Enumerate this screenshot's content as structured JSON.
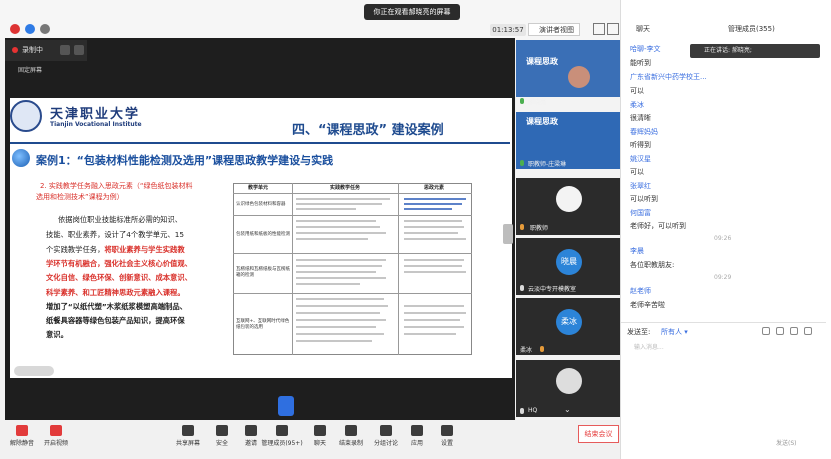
{
  "top_bar": {
    "share_banner": "你正在观看郝晓亮的屏幕",
    "timer": "01:13:57",
    "view_mode": "演讲者视图"
  },
  "stage": {
    "recording_label": "录制中",
    "pin_label": "固定屏幕"
  },
  "slide": {
    "university_cn": "天津职业大学",
    "university_en": "Tianjin Vocational Institute",
    "section_title": "四、“课程思政” 建设案例",
    "case_title": "案例1：“包装材料性能检测及选用”课程思政教学建设与实践",
    "subheading_line1": "2. 实践教学任务融入思政元素（“绿色纸包装材料",
    "subheading_line2": "选用和检测技术”课程为例）",
    "body": {
      "l1": "依据岗位职业技能标准所必需的知识、",
      "l2": "技能、职业素养，设计了4个教学单元、15",
      "l3a": "个实践教学任务，",
      "l3b": "将职业素养与学生实践教",
      "l4": "学环节有机融合，强化社会主义核心价值观、",
      "l5": "文化自信、绿色环保、创新意识、成本意识、",
      "l6": "科学素养、和工匠精神思政元素融入课程。",
      "l7": "增加了“以纸代塑”木浆纸浆模塑高端制品、",
      "l8": "纸餐具容器等绿色包装产品知识，提高环保",
      "l9": "意识。"
    },
    "table": {
      "headers": [
        "教学单元",
        "实践教学任务",
        "思政元素"
      ],
      "unit_1": "认识绿色包装材料和容器",
      "unit_2": "包装用纸和纸板的性能检测",
      "unit_3": "瓦楞纸和瓦楞纸板与瓦楞纸箱的检测",
      "unit_4": "互联网+、互联网时代绿色纸包装的选用"
    }
  },
  "videos": [
    {
      "name": "郝晓亮",
      "banner": "课程思政"
    },
    {
      "name": "职教师-庄梁琳",
      "banner": "课程思政"
    },
    {
      "name": "职教师"
    },
    {
      "name": "云淡中专开模教室",
      "avatar": "晓晨"
    },
    {
      "name": "柔冰",
      "avatar": "柔冰"
    },
    {
      "name": "HQ"
    }
  ],
  "toolbar": {
    "mic": "解除静音",
    "video": "开启视频",
    "share": "共享屏幕",
    "security": "安全",
    "invite": "邀请",
    "members": "管理成员(95+)",
    "chat": "聊天",
    "record": "结束录制",
    "breakout": "分组讨论",
    "apps": "应用",
    "settings": "设置",
    "end_meeting": "结束会议"
  },
  "chat_panel": {
    "title": "聊天",
    "members_title": "管理成员(355)",
    "speaking": "正在讲话: 郝晓亮;",
    "messages": [
      {
        "type": "name",
        "text": "哈聊-李文"
      },
      {
        "type": "text",
        "text": "能听到"
      },
      {
        "type": "name",
        "text": "广东省新兴中药学校王..."
      },
      {
        "type": "text",
        "text": "可以"
      },
      {
        "type": "name",
        "text": "柔冰"
      },
      {
        "type": "text",
        "text": "很清晰"
      },
      {
        "type": "name",
        "text": "春辉妈妈"
      },
      {
        "type": "text",
        "text": "听得到"
      },
      {
        "type": "name",
        "text": "姚汉星"
      },
      {
        "type": "text",
        "text": "可以"
      },
      {
        "type": "name",
        "text": "张翠红"
      },
      {
        "type": "text",
        "text": "可以听到"
      },
      {
        "type": "name",
        "text": "何国富"
      },
      {
        "type": "text",
        "text": "老师好，可以听到"
      },
      {
        "type": "time",
        "text": "09:26"
      },
      {
        "type": "name",
        "text": "李晨"
      },
      {
        "type": "text",
        "text": "各位职教朋友:"
      },
      {
        "type": "time",
        "text": "09:29"
      },
      {
        "type": "name",
        "text": "赵老师"
      },
      {
        "type": "text",
        "text": "老师辛苦啦"
      }
    ],
    "send_to_label": "发送至:",
    "send_to_value": "所有人 ▾",
    "placeholder": "输入消息...",
    "send_button": "发送(S)"
  }
}
